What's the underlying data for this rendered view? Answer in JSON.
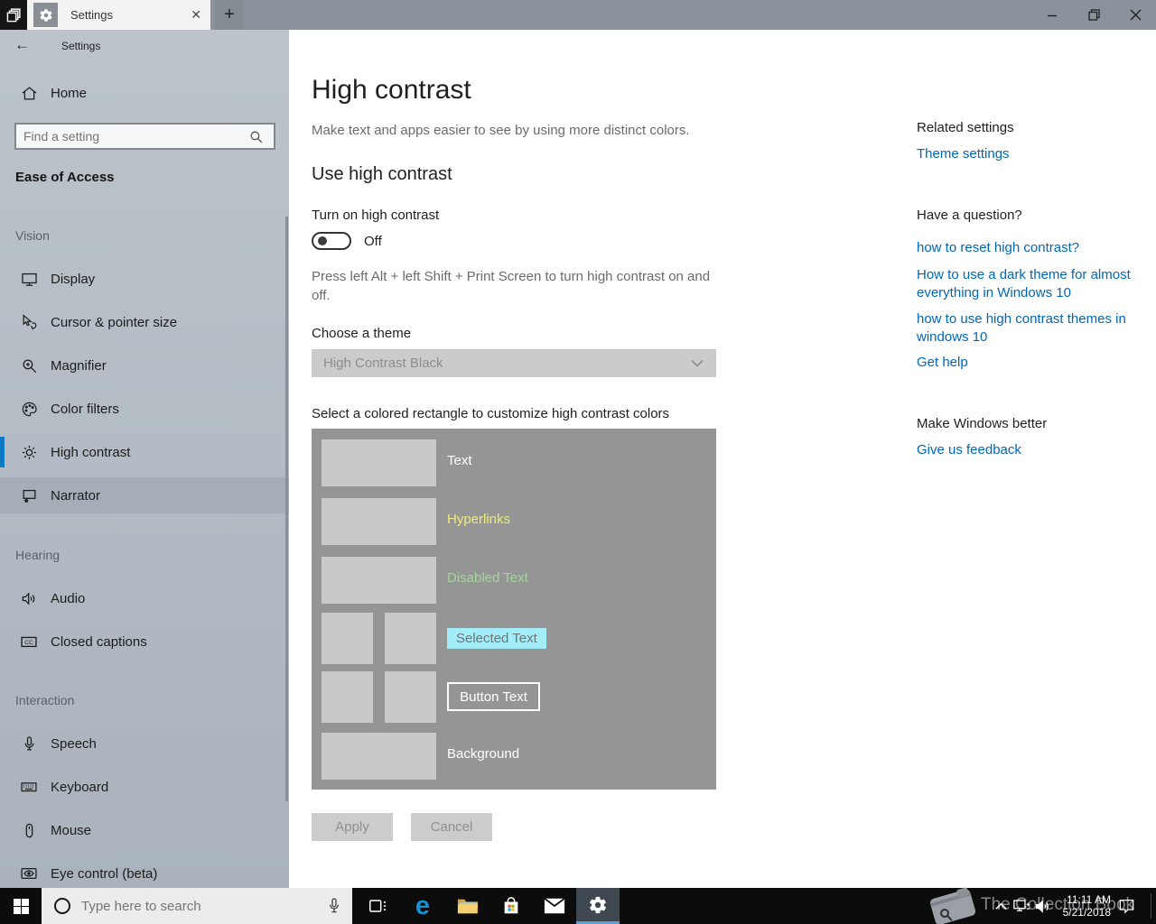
{
  "window": {
    "tab": {
      "title": "Settings",
      "close_glyph": "✕",
      "new_tab_glyph": "+"
    },
    "controls": {
      "minimize": "minimize",
      "restore": "restore",
      "close": "close"
    }
  },
  "sidebar": {
    "header_title": "Settings",
    "home_label": "Home",
    "search_placeholder": "Find a setting",
    "section_title": "Ease of Access",
    "groups": [
      {
        "label": "Vision",
        "items": [
          {
            "label": "Display",
            "icon": "display-icon"
          },
          {
            "label": "Cursor & pointer size",
            "icon": "cursor-pointer-icon"
          },
          {
            "label": "Magnifier",
            "icon": "magnifier-icon"
          },
          {
            "label": "Color filters",
            "icon": "color-filters-icon"
          },
          {
            "label": "High contrast",
            "icon": "high-contrast-sun-icon",
            "selected": true
          },
          {
            "label": "Narrator",
            "icon": "narrator-icon",
            "hovered": true
          }
        ]
      },
      {
        "label": "Hearing",
        "items": [
          {
            "label": "Audio",
            "icon": "speaker-icon"
          },
          {
            "label": "Closed captions",
            "icon": "closed-captions-icon"
          }
        ]
      },
      {
        "label": "Interaction",
        "items": [
          {
            "label": "Speech",
            "icon": "microphone-icon"
          },
          {
            "label": "Keyboard",
            "icon": "keyboard-icon"
          },
          {
            "label": "Mouse",
            "icon": "mouse-icon"
          },
          {
            "label": "Eye control (beta)",
            "icon": "eye-control-icon"
          }
        ]
      }
    ]
  },
  "main": {
    "title": "High contrast",
    "subtitle": "Make text and apps easier to see by using more distinct colors.",
    "section_title": "Use high contrast",
    "toggle_label": "Turn on high contrast",
    "toggle_state": "Off",
    "shortcut_hint": "Press left Alt + left Shift + Print Screen to turn high contrast on and off.",
    "theme_label": "Choose a theme",
    "theme_value": "High Contrast Black",
    "picker_caption": "Select a colored rectangle to customize high contrast colors",
    "panel_rows": [
      {
        "label": "Text"
      },
      {
        "label": "Hyperlinks"
      },
      {
        "label": "Disabled Text"
      },
      {
        "label": "Selected Text"
      },
      {
        "label": "Button Text"
      },
      {
        "label": "Background"
      }
    ],
    "apply_label": "Apply",
    "cancel_label": "Cancel"
  },
  "right": {
    "related_title": "Related settings",
    "related_links": [
      "Theme settings"
    ],
    "question_title": "Have a question?",
    "question_links": [
      "how to reset high contrast?",
      "How to use a dark theme for almost everything in Windows 10",
      "how to use high contrast themes in windows 10",
      "Get help"
    ],
    "better_title": "Make Windows better",
    "feedback_link": "Give us feedback"
  },
  "taskbar": {
    "search_placeholder": "Type here to search",
    "clock_time": "11:11 AM",
    "clock_date": "5/21/2018",
    "apps": [
      "edge",
      "file-explorer",
      "store",
      "mail",
      "settings"
    ],
    "active_app": "settings"
  },
  "watermark": {
    "text": "The Collection Book"
  },
  "icons": {
    "tab_left_button": "stacked-tabs",
    "tab_app": "gear",
    "search": "magnifier",
    "start": "windows-logo",
    "tray": [
      "hidden-icons-chevron",
      "network",
      "volume",
      "action-center"
    ]
  },
  "colors": {
    "accent_blue": "#0f7ac4",
    "link_blue": "#0067b8",
    "hyperlink_yellow": "#ecec7d",
    "disabled_text_green": "#a5d69e",
    "selected_text_cyan": "#a2edf8",
    "panel_gray": "#959595",
    "swatch_gray": "#c9c9c9",
    "sidebar_gray": "#b4bcc4",
    "taskbar_black": "#0c0c0c",
    "edge_blue": "#1793d5"
  }
}
